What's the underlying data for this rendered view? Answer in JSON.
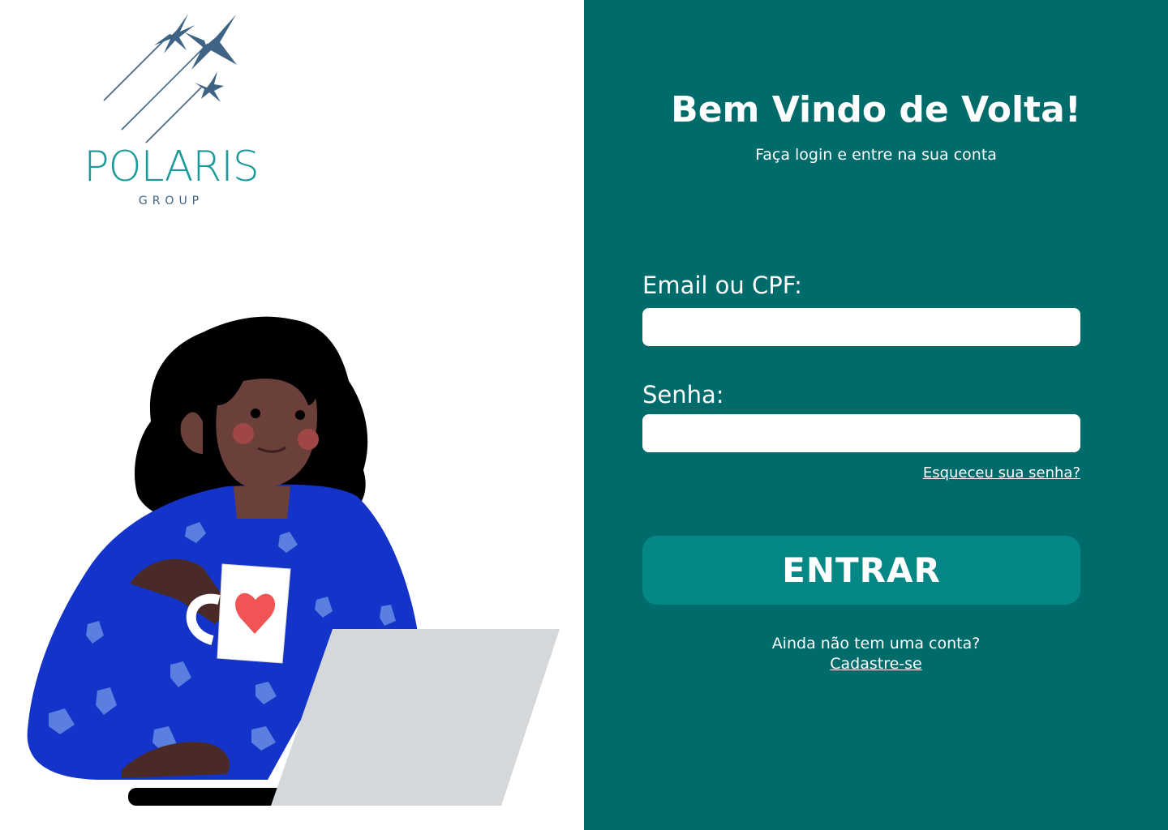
{
  "brand": {
    "name": "POLARIS",
    "subtitle": "GROUP",
    "logo_icon": "stars-icon",
    "colors": {
      "wordmark": "#1a9a9a",
      "stars": "#3e6385"
    }
  },
  "illustration": {
    "icon": "woman-with-coffee-and-laptop"
  },
  "login": {
    "title": "Bem Vindo de Volta!",
    "subtitle": "Faça login e entre na sua conta",
    "email_label": "Email ou CPF:",
    "email_value": "",
    "password_label": "Senha:",
    "password_value": "",
    "forgot_link": "Esqueceu sua senha?",
    "submit_label": "ENTRAR",
    "signup_prompt": "Ainda não tem uma conta?",
    "signup_link": "Cadastre-se"
  },
  "colors": {
    "panel": "#006b6b",
    "button": "#058785",
    "text": "#ffffff"
  }
}
